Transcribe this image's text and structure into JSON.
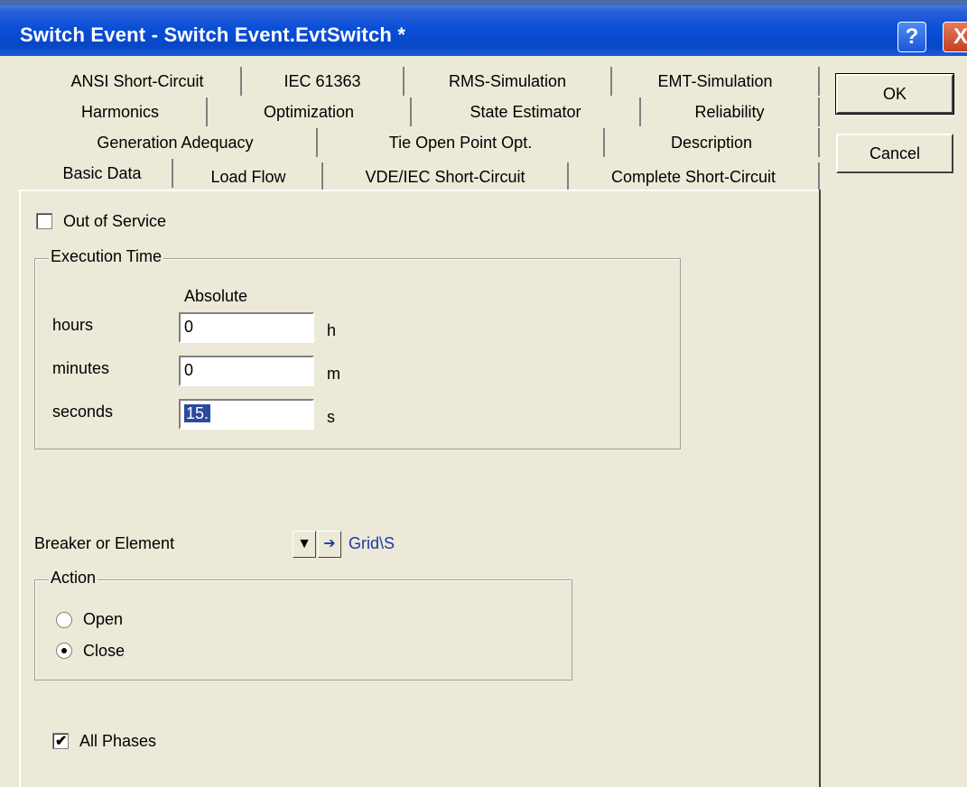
{
  "window": {
    "title": "Switch Event - Switch Event.EvtSwitch *",
    "help_label": "?",
    "close_label": "X"
  },
  "tabs": {
    "row1": [
      "ANSI Short-Circuit",
      "IEC 61363",
      "RMS-Simulation",
      "EMT-Simulation"
    ],
    "row2": [
      "Harmonics",
      "Optimization",
      "State Estimator",
      "Reliability"
    ],
    "row3": [
      "Generation Adequacy",
      "Tie Open Point Opt.",
      "Description"
    ],
    "row4": [
      "Basic Data",
      "Load Flow",
      "VDE/IEC Short-Circuit",
      "Complete Short-Circuit"
    ],
    "active": "Basic Data"
  },
  "buttons": {
    "ok": "OK",
    "cancel": "Cancel"
  },
  "basic": {
    "out_of_service": {
      "label": "Out of Service",
      "checked": false
    },
    "execution_time": {
      "legend": "Execution Time",
      "column_header": "Absolute",
      "rows": [
        {
          "label": "hours",
          "value": "0",
          "unit": "h"
        },
        {
          "label": "minutes",
          "value": "0",
          "unit": "m"
        },
        {
          "label": "seconds",
          "value": "15.",
          "unit": "s",
          "selected": true
        }
      ]
    },
    "breaker": {
      "label": "Breaker or Element",
      "dropdown_icon": "triangle-down-icon",
      "jump_icon": "arrow-right-icon",
      "value": "Grid\\S"
    },
    "action": {
      "legend": "Action",
      "options": [
        {
          "label": "Open",
          "selected": false
        },
        {
          "label": "Close",
          "selected": true
        }
      ]
    },
    "all_phases": {
      "label": "All Phases",
      "checked": true
    }
  }
}
